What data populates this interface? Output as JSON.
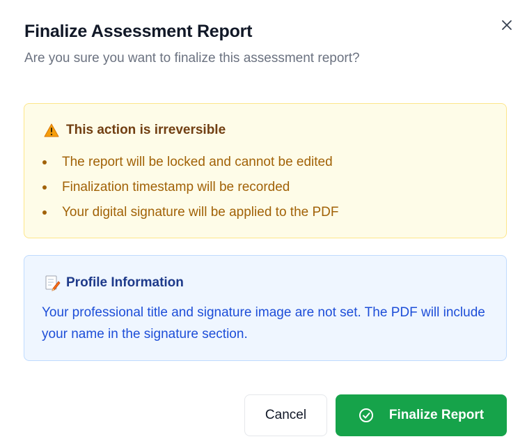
{
  "dialog": {
    "title": "Finalize Assessment Report",
    "subtitle": "Are you sure you want to finalize this assessment report?"
  },
  "warning": {
    "icon": "warning-icon",
    "title": "This action is irreversible",
    "items": [
      "The report will be locked and cannot be edited",
      "Finalization timestamp will be recorded",
      "Your digital signature will be applied to the PDF"
    ]
  },
  "profile_info": {
    "icon": "memo-icon",
    "title": "Profile Information",
    "text": "Your professional title and signature image are not set. The PDF will include your name in the signature section."
  },
  "actions": {
    "cancel_label": "Cancel",
    "finalize_label": "Finalize Report"
  },
  "colors": {
    "primary": "#16a34a",
    "warning_bg": "#fefce8",
    "warning_text": "#a16207",
    "info_bg": "#eff6ff",
    "info_text": "#1d4ed8"
  }
}
